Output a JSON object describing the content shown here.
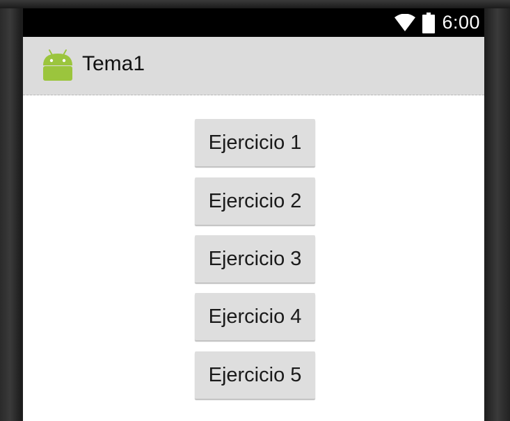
{
  "status_bar": {
    "time": "6:00",
    "icons": [
      "wifi-icon",
      "battery-icon"
    ]
  },
  "action_bar": {
    "app_icon": "android-robot-icon",
    "title": "Tema1"
  },
  "buttons": [
    {
      "label": "Ejercicio 1"
    },
    {
      "label": "Ejercicio 2"
    },
    {
      "label": "Ejercicio 3"
    },
    {
      "label": "Ejercicio 4"
    },
    {
      "label": "Ejercicio 5"
    }
  ],
  "colors": {
    "status_bar": "#000000",
    "action_bar": "#dcdcdc",
    "button": "#dedede",
    "android_green": "#a4c639"
  }
}
